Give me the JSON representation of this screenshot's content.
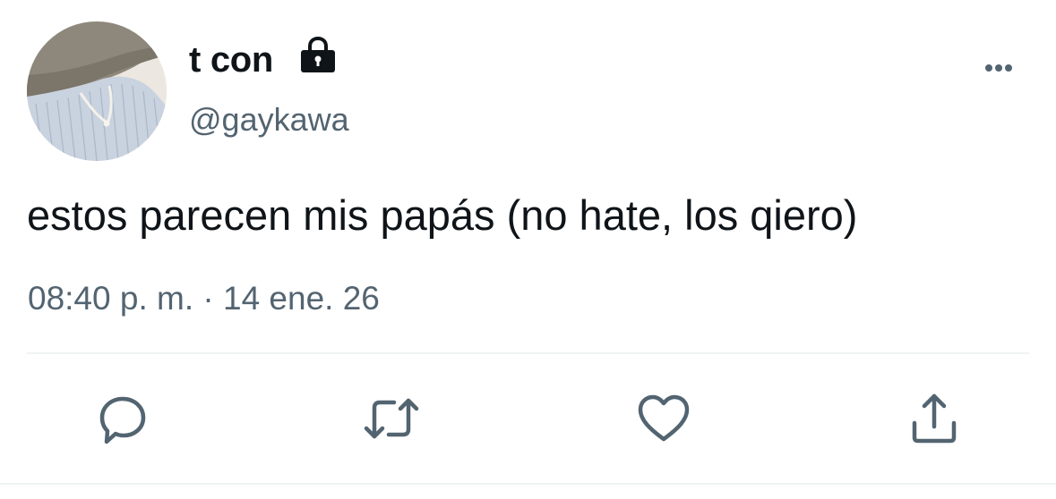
{
  "tweet": {
    "author": {
      "display_name": "t con",
      "handle": "@gaykawa",
      "protected_icon": "lock-icon",
      "avatar": "avatar"
    },
    "text": "estos parecen mis papás (no hate, los qiero)",
    "timestamp": "08:40 p. m. · 14 ene. 26",
    "more_icon": "more-icon"
  },
  "actions": [
    {
      "name": "reply",
      "icon": "reply-icon"
    },
    {
      "name": "retweet",
      "icon": "retweet-icon"
    },
    {
      "name": "like",
      "icon": "heart-icon"
    },
    {
      "name": "share",
      "icon": "share-icon"
    }
  ],
  "colors": {
    "text": "#0f1419",
    "secondary": "#536471",
    "divider": "#eff3f4",
    "background": "#ffffff"
  }
}
